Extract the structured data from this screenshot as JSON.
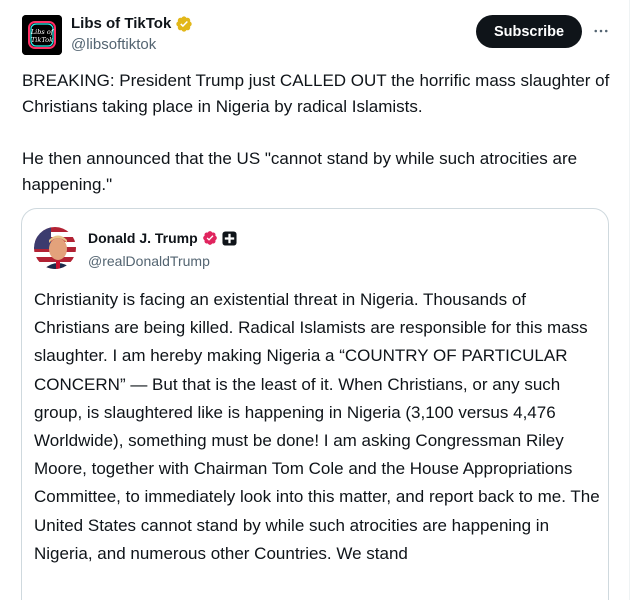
{
  "post": {
    "author": {
      "display_name": "Libs of TikTok",
      "handle": "@libsoftiktok",
      "verified_badge_color": "#e2b719",
      "avatar_icon": "libs-of-tiktok-logo"
    },
    "subscribe_label": "Subscribe",
    "more_icon": "more-horizontal-icon",
    "text": "BREAKING: President Trump just CALLED OUT the horrific mass slaughter of Christians taking place in Nigeria by radical Islamists.\n\nHe then announced that the US \"cannot stand by while such atrocities are happening.\""
  },
  "quote": {
    "author": {
      "display_name": "Donald J. Trump",
      "handle": "@realDonaldTrump",
      "verified_badge_color": "#e0245e",
      "affiliate_badge_icon": "government-affiliate-icon"
    },
    "text": "Christianity is facing an existential threat in Nigeria. Thousands of Christians are being killed. Radical Islamists are responsible for this mass slaughter. I am hereby making Nigeria a “COUNTRY OF PARTICULAR CONCERN” — But that is the least of it. When Christians, or any such group, is slaughtered like is happening in Nigeria (3,100 versus 4,476 Worldwide), something must be done! I am asking Congressman Riley Moore, together with Chairman Tom Cole and the House Appropriations Committee, to immediately look into this matter, and report back to me. The United States cannot stand by while such atrocities are happening in Nigeria, and numerous other Countries. We stand"
  },
  "colors": {
    "text_primary": "#0f1419",
    "text_secondary": "#536471",
    "border": "#cfd9de",
    "button_bg": "#0f1419"
  }
}
